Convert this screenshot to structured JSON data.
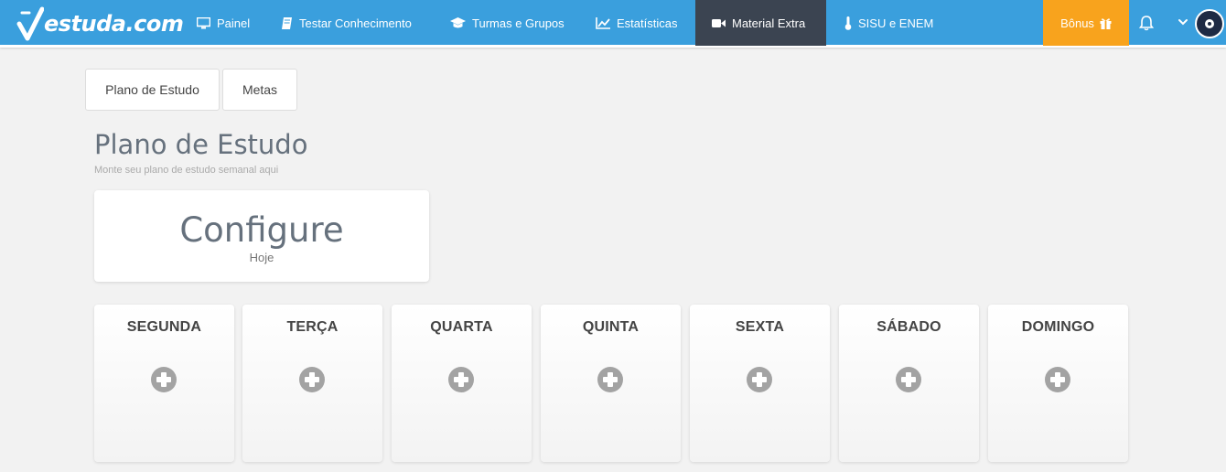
{
  "brand": {
    "logo_text": "estuda.com",
    "nav_color": "#3a9fdd",
    "active_color": "#3b4451",
    "bonus_color": "#f8a31d"
  },
  "nav": {
    "items": [
      {
        "label": "Painel",
        "icon": "monitor-icon"
      },
      {
        "label": "Testar Conhecimento",
        "icon": "book-icon"
      },
      {
        "label": "Turmas e Grupos",
        "icon": "graduation-cap-icon"
      },
      {
        "label": "Estatísticas",
        "icon": "line-chart-icon"
      },
      {
        "label": "Material Extra",
        "icon": "video-camera-icon",
        "active": true
      },
      {
        "label": "SISU e ENEM",
        "icon": "thermometer-icon"
      }
    ],
    "bonus_label": "Bônus",
    "bonus_icon": "gift-icon",
    "bell_icon": "bell-icon",
    "chevron_icon": "chevron-down-icon"
  },
  "tabs": [
    {
      "label": "Plano de Estudo"
    },
    {
      "label": "Metas"
    }
  ],
  "header": {
    "title": "Plano de Estudo",
    "subtitle": "Monte seu plano de estudo semanal aqui"
  },
  "config": {
    "title": "Configure",
    "subtitle": "Hoje"
  },
  "days": [
    {
      "label": "SEGUNDA"
    },
    {
      "label": "TERÇA"
    },
    {
      "label": "QUARTA"
    },
    {
      "label": "QUINTA"
    },
    {
      "label": "SEXTA"
    },
    {
      "label": "SÁBADO"
    },
    {
      "label": "DOMINGO"
    }
  ],
  "day_add_icon": "plus-circle-icon"
}
